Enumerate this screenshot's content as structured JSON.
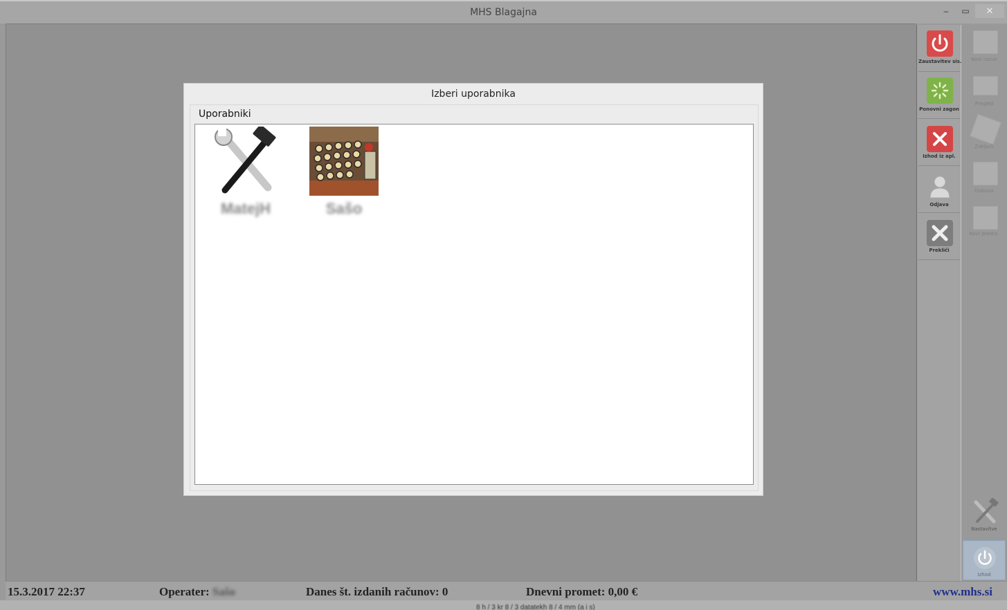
{
  "window": {
    "title": "MHS Blagajna",
    "minimize_glyph": "–",
    "maximize_glyph": "▭",
    "close_glyph": "✕"
  },
  "dialog": {
    "title": "Izberi uporabnika",
    "group_label": "Uporabniki",
    "users": [
      {
        "name": "MatejH",
        "icon": "tools-wrench-hammer-icon"
      },
      {
        "name": "Sašo",
        "icon": "cash-register-photo-icon"
      }
    ]
  },
  "toolbar_primary": {
    "items": [
      {
        "label": "Zaustavitev sis.",
        "icon": "power-icon",
        "color": "#d94a4a"
      },
      {
        "label": "Ponovni zagon",
        "icon": "restart-icon",
        "color": "#7fb34a"
      },
      {
        "label": "Izhod iz apl.",
        "icon": "exit-x-icon",
        "color": "#d64545"
      },
      {
        "label": "Odjava",
        "icon": "user-logout-icon",
        "color": "#c9c9c9"
      },
      {
        "label": "Prekliči",
        "icon": "cancel-x-icon",
        "color": "#7d7d7d"
      }
    ]
  },
  "toolbar_secondary": {
    "items": [
      {
        "label": "Novi račun",
        "icon": "new-invoice-icon"
      },
      {
        "label": "Pregled",
        "icon": "overview-icon"
      },
      {
        "label": "Zaključi",
        "icon": "close-day-icon"
      },
      {
        "label": "Dobava",
        "icon": "delivery-icon"
      },
      {
        "label": "Novi predra.",
        "icon": "new-proforma-icon"
      }
    ],
    "bottom_items": [
      {
        "label": "Nastavitve",
        "icon": "settings-tools-icon"
      },
      {
        "label": "Izhod",
        "icon": "exit-power-icon"
      }
    ]
  },
  "statusbar": {
    "datetime": "15.3.2017 22:37",
    "operator_label": "Operater:",
    "operator_value": "Sašo",
    "invoices": "Danes št. izdanih računov: 0",
    "turnover": "Dnevni promet: 0,00 €",
    "website": "www.mhs.si",
    "footer_text": "8 h / 3 kr 8 / 3 datatekh 8 / 4 mm (a i s)"
  }
}
